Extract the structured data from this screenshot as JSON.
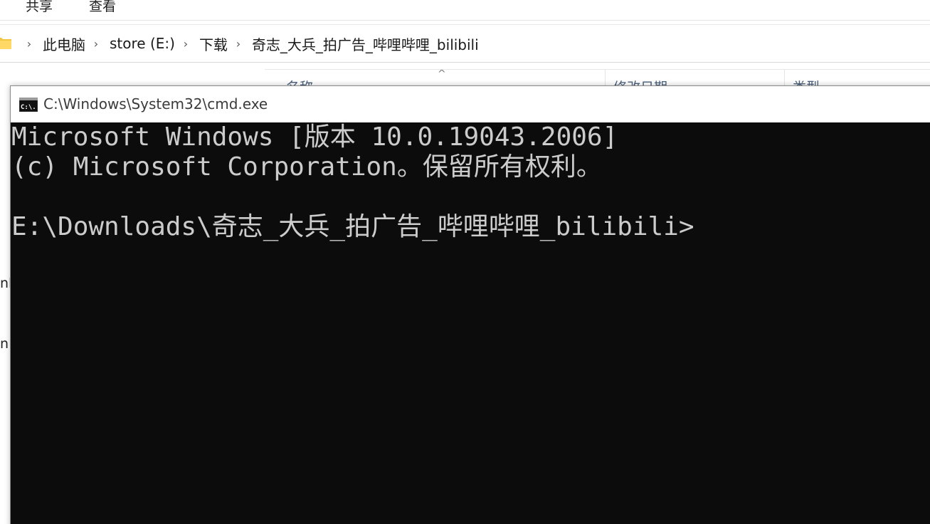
{
  "explorer": {
    "ribbon_tabs": [
      "共享",
      "查看"
    ],
    "breadcrumb": [
      "此电脑",
      "store (E:)",
      "下载",
      "奇志_大兵_拍广告_哔哩哔哩_bilibili"
    ],
    "breadcrumb_separator": "›",
    "sort_caret": "^",
    "columns": [
      "名称",
      "修改日期",
      "类型"
    ],
    "sidebar_fragments": [
      "nlo",
      "n"
    ]
  },
  "cmd": {
    "title": "C:\\Windows\\System32\\cmd.exe",
    "icon_label": "C:\\.",
    "lines": [
      "Microsoft Windows [版本 10.0.19043.2006]",
      "(c) Microsoft Corporation。保留所有权利。",
      "",
      "E:\\Downloads\\奇志_大兵_拍广告_哔哩哔哩_bilibili>"
    ]
  },
  "colors": {
    "console_bg": "#0c0c0c",
    "console_fg": "#cccccc",
    "column_header": "#4c607a",
    "folder_yellow": "#f4c542"
  }
}
